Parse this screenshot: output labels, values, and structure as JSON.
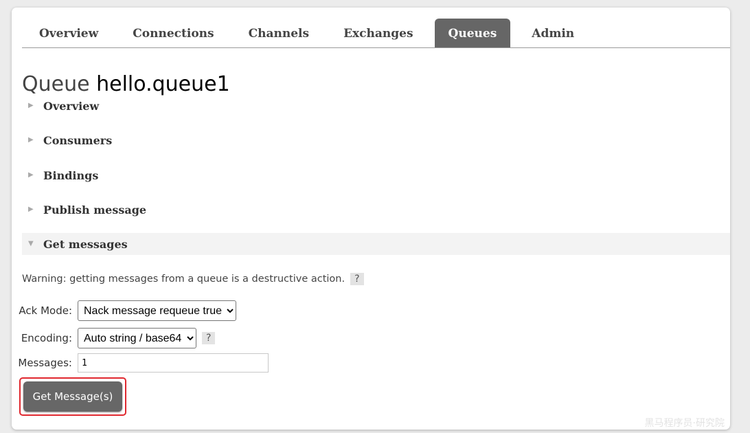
{
  "nav": {
    "tabs": [
      {
        "label": "Overview"
      },
      {
        "label": "Connections"
      },
      {
        "label": "Channels"
      },
      {
        "label": "Exchanges"
      },
      {
        "label": "Queues",
        "active": true
      },
      {
        "label": "Admin"
      }
    ]
  },
  "page": {
    "title_prefix": "Queue",
    "queue_name": "hello.queue1"
  },
  "sections": [
    {
      "label": "Overview",
      "expanded": false
    },
    {
      "label": "Consumers",
      "expanded": false
    },
    {
      "label": "Bindings",
      "expanded": false
    },
    {
      "label": "Publish message",
      "expanded": false
    },
    {
      "label": "Get messages",
      "expanded": true
    }
  ],
  "get_messages": {
    "warning": "Warning: getting messages from a queue is a destructive action.",
    "help_label": "?",
    "ack_mode": {
      "label": "Ack Mode:",
      "value": "Nack message requeue true"
    },
    "encoding": {
      "label": "Encoding:",
      "value": "Auto string / base64"
    },
    "messages": {
      "label": "Messages:",
      "value": "1"
    },
    "button_label": "Get Message(s)"
  },
  "watermark": "黑马程序员·研究院",
  "colors": {
    "active_tab": "#666666",
    "highlight_border": "#e0282f",
    "button": "#676767"
  }
}
